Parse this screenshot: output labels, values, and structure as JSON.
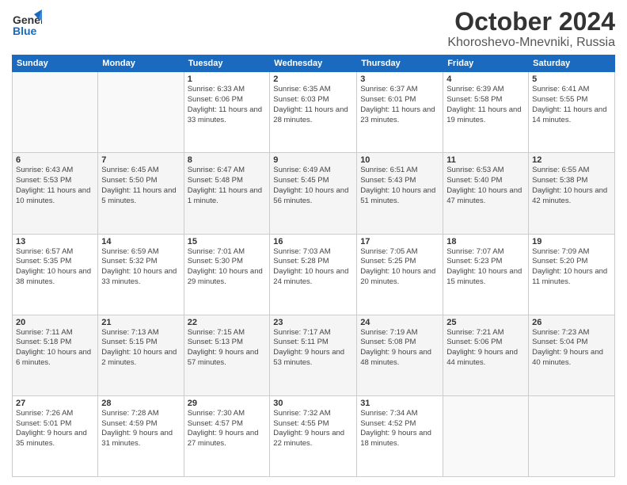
{
  "header": {
    "logo_general": "General",
    "logo_blue": "Blue",
    "title": "October 2024",
    "subtitle": "Khoroshevo-Mnevniki, Russia"
  },
  "days_of_week": [
    "Sunday",
    "Monday",
    "Tuesday",
    "Wednesday",
    "Thursday",
    "Friday",
    "Saturday"
  ],
  "weeks": [
    [
      {
        "day": "",
        "info": ""
      },
      {
        "day": "",
        "info": ""
      },
      {
        "day": "1",
        "info": "Sunrise: 6:33 AM\nSunset: 6:06 PM\nDaylight: 11 hours and 33 minutes."
      },
      {
        "day": "2",
        "info": "Sunrise: 6:35 AM\nSunset: 6:03 PM\nDaylight: 11 hours and 28 minutes."
      },
      {
        "day": "3",
        "info": "Sunrise: 6:37 AM\nSunset: 6:01 PM\nDaylight: 11 hours and 23 minutes."
      },
      {
        "day": "4",
        "info": "Sunrise: 6:39 AM\nSunset: 5:58 PM\nDaylight: 11 hours and 19 minutes."
      },
      {
        "day": "5",
        "info": "Sunrise: 6:41 AM\nSunset: 5:55 PM\nDaylight: 11 hours and 14 minutes."
      }
    ],
    [
      {
        "day": "6",
        "info": "Sunrise: 6:43 AM\nSunset: 5:53 PM\nDaylight: 11 hours and 10 minutes."
      },
      {
        "day": "7",
        "info": "Sunrise: 6:45 AM\nSunset: 5:50 PM\nDaylight: 11 hours and 5 minutes."
      },
      {
        "day": "8",
        "info": "Sunrise: 6:47 AM\nSunset: 5:48 PM\nDaylight: 11 hours and 1 minute."
      },
      {
        "day": "9",
        "info": "Sunrise: 6:49 AM\nSunset: 5:45 PM\nDaylight: 10 hours and 56 minutes."
      },
      {
        "day": "10",
        "info": "Sunrise: 6:51 AM\nSunset: 5:43 PM\nDaylight: 10 hours and 51 minutes."
      },
      {
        "day": "11",
        "info": "Sunrise: 6:53 AM\nSunset: 5:40 PM\nDaylight: 10 hours and 47 minutes."
      },
      {
        "day": "12",
        "info": "Sunrise: 6:55 AM\nSunset: 5:38 PM\nDaylight: 10 hours and 42 minutes."
      }
    ],
    [
      {
        "day": "13",
        "info": "Sunrise: 6:57 AM\nSunset: 5:35 PM\nDaylight: 10 hours and 38 minutes."
      },
      {
        "day": "14",
        "info": "Sunrise: 6:59 AM\nSunset: 5:32 PM\nDaylight: 10 hours and 33 minutes."
      },
      {
        "day": "15",
        "info": "Sunrise: 7:01 AM\nSunset: 5:30 PM\nDaylight: 10 hours and 29 minutes."
      },
      {
        "day": "16",
        "info": "Sunrise: 7:03 AM\nSunset: 5:28 PM\nDaylight: 10 hours and 24 minutes."
      },
      {
        "day": "17",
        "info": "Sunrise: 7:05 AM\nSunset: 5:25 PM\nDaylight: 10 hours and 20 minutes."
      },
      {
        "day": "18",
        "info": "Sunrise: 7:07 AM\nSunset: 5:23 PM\nDaylight: 10 hours and 15 minutes."
      },
      {
        "day": "19",
        "info": "Sunrise: 7:09 AM\nSunset: 5:20 PM\nDaylight: 10 hours and 11 minutes."
      }
    ],
    [
      {
        "day": "20",
        "info": "Sunrise: 7:11 AM\nSunset: 5:18 PM\nDaylight: 10 hours and 6 minutes."
      },
      {
        "day": "21",
        "info": "Sunrise: 7:13 AM\nSunset: 5:15 PM\nDaylight: 10 hours and 2 minutes."
      },
      {
        "day": "22",
        "info": "Sunrise: 7:15 AM\nSunset: 5:13 PM\nDaylight: 9 hours and 57 minutes."
      },
      {
        "day": "23",
        "info": "Sunrise: 7:17 AM\nSunset: 5:11 PM\nDaylight: 9 hours and 53 minutes."
      },
      {
        "day": "24",
        "info": "Sunrise: 7:19 AM\nSunset: 5:08 PM\nDaylight: 9 hours and 48 minutes."
      },
      {
        "day": "25",
        "info": "Sunrise: 7:21 AM\nSunset: 5:06 PM\nDaylight: 9 hours and 44 minutes."
      },
      {
        "day": "26",
        "info": "Sunrise: 7:23 AM\nSunset: 5:04 PM\nDaylight: 9 hours and 40 minutes."
      }
    ],
    [
      {
        "day": "27",
        "info": "Sunrise: 7:26 AM\nSunset: 5:01 PM\nDaylight: 9 hours and 35 minutes."
      },
      {
        "day": "28",
        "info": "Sunrise: 7:28 AM\nSunset: 4:59 PM\nDaylight: 9 hours and 31 minutes."
      },
      {
        "day": "29",
        "info": "Sunrise: 7:30 AM\nSunset: 4:57 PM\nDaylight: 9 hours and 27 minutes."
      },
      {
        "day": "30",
        "info": "Sunrise: 7:32 AM\nSunset: 4:55 PM\nDaylight: 9 hours and 22 minutes."
      },
      {
        "day": "31",
        "info": "Sunrise: 7:34 AM\nSunset: 4:52 PM\nDaylight: 9 hours and 18 minutes."
      },
      {
        "day": "",
        "info": ""
      },
      {
        "day": "",
        "info": ""
      }
    ]
  ]
}
